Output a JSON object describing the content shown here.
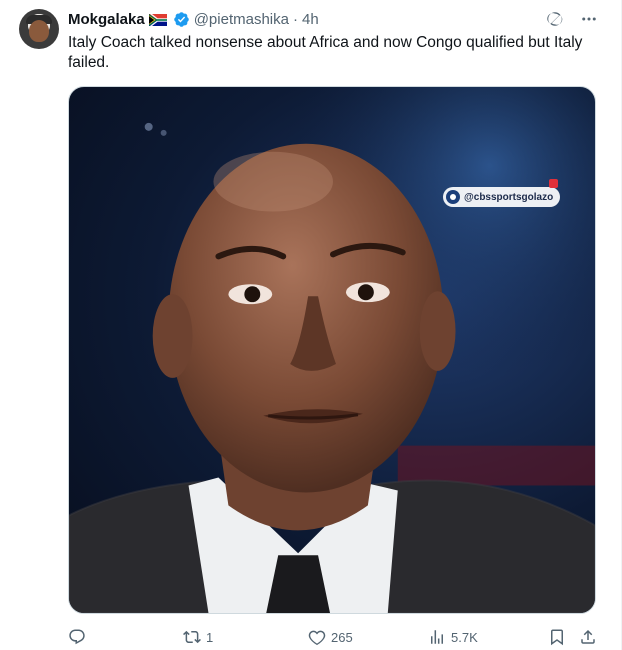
{
  "tweet": {
    "display_name": "Mokgalaka",
    "handle": "@pietmashika",
    "separator": "·",
    "time": "4h",
    "text": "Italy Coach talked nonsense about Africa and now Congo qualified but Italy failed.",
    "media": {
      "watermark": "@cbssportsgolazo"
    }
  },
  "header_icons": [
    "grok-icon",
    "more-icon"
  ],
  "actions": {
    "reply": {
      "icon": "reply-icon",
      "count": ""
    },
    "retweet": {
      "icon": "retweet-icon",
      "count": "1"
    },
    "like": {
      "icon": "heart-icon",
      "count": "265"
    },
    "views": {
      "icon": "views-icon",
      "count": "5.7K"
    },
    "bookmark": {
      "icon": "bookmark-icon"
    },
    "share": {
      "icon": "share-icon"
    }
  },
  "colors": {
    "verified": "#1d9bf0",
    "muted": "#536471",
    "text": "#0f1419"
  }
}
